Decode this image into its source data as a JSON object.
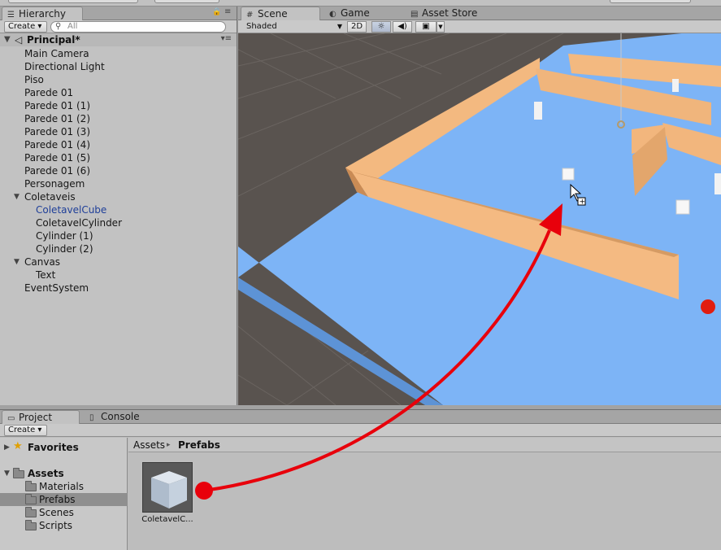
{
  "colors": {
    "accent_red": "#e8000b",
    "floor": "#7db4f6",
    "wall": "#f3b980",
    "prefab_text": "#1f3f99"
  },
  "hierarchy": {
    "tab_label": "Hierarchy",
    "create_label": "Create ▾",
    "search_placeholder": "All",
    "scene_name": "Principal*",
    "items": [
      {
        "label": "Main Camera"
      },
      {
        "label": "Directional Light"
      },
      {
        "label": "Piso"
      },
      {
        "label": "Parede 01"
      },
      {
        "label": "Parede 01 (1)"
      },
      {
        "label": "Parede 01 (2)"
      },
      {
        "label": "Parede 01 (3)"
      },
      {
        "label": "Parede 01 (4)"
      },
      {
        "label": "Parede 01 (5)"
      },
      {
        "label": "Parede 01 (6)"
      },
      {
        "label": "Personagem"
      },
      {
        "label": "Coletaveis"
      },
      {
        "label": "ColetavelCube"
      },
      {
        "label": "ColetavelCylinder"
      },
      {
        "label": "Cylinder (1)"
      },
      {
        "label": "Cylinder (2)"
      },
      {
        "label": "Canvas"
      },
      {
        "label": "Text"
      },
      {
        "label": "EventSystem"
      }
    ]
  },
  "scene": {
    "tabs": [
      {
        "label": "Scene"
      },
      {
        "label": "Game"
      },
      {
        "label": "Asset Store"
      }
    ],
    "shading_mode": "Shaded",
    "mode_2d_label": "2D"
  },
  "project": {
    "tabs": [
      {
        "label": "Project"
      },
      {
        "label": "Console"
      }
    ],
    "create_label": "Create ▾",
    "tree": [
      {
        "label": "Favorites"
      },
      {
        "label": "Assets"
      },
      {
        "label": "Materials"
      },
      {
        "label": "Prefabs"
      },
      {
        "label": "Scenes"
      },
      {
        "label": "Scripts"
      }
    ],
    "breadcrumb": {
      "root": "Assets",
      "separator": "▸",
      "current": "Prefabs"
    },
    "assets": [
      {
        "label": "ColetavelC..."
      }
    ]
  }
}
